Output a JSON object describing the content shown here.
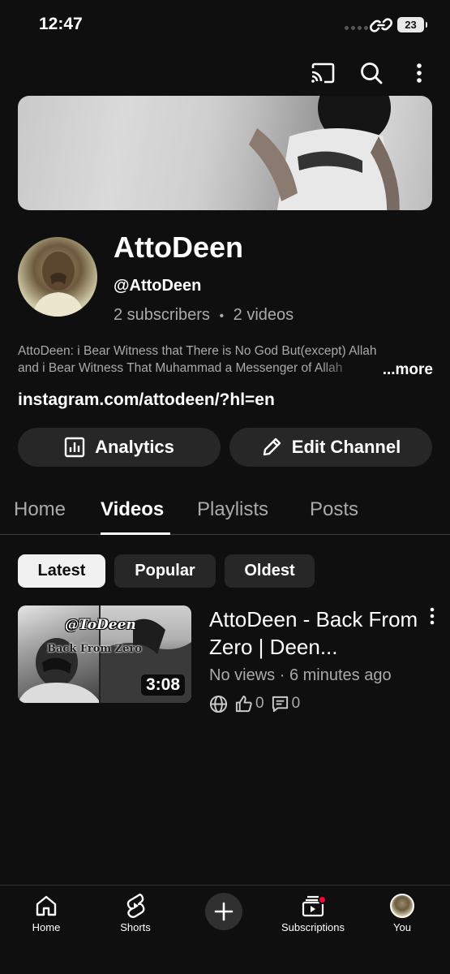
{
  "status_bar": {
    "time": "12:47",
    "battery": "23",
    "icons": [
      "signal-dots-icon",
      "link-icon",
      "battery-icon"
    ]
  },
  "top_bar": {
    "icons": [
      "cast-icon",
      "search-icon",
      "more-vert-icon"
    ]
  },
  "channel": {
    "name": "AttoDeen",
    "handle": "@AttoDeen",
    "subscribers": "2 subscribers",
    "separator": "•",
    "videos": "2 videos",
    "description_line1": "AttoDeen: i Bear Witness that There is No God But(except) Allah",
    "description_line2": "and i Bear Witness That Muhammad a Messenger of Allah",
    "description_more": "...more",
    "link": "instagram.com/attodeen/?hl=en"
  },
  "actions": {
    "analytics_label": "Analytics",
    "edit_label": "Edit Channel"
  },
  "tabs": [
    {
      "label": "Home",
      "active": false
    },
    {
      "label": "Videos",
      "active": true
    },
    {
      "label": "Playlists",
      "active": false
    },
    {
      "label": "Posts",
      "active": false
    }
  ],
  "filters": [
    {
      "label": "Latest",
      "active": true
    },
    {
      "label": "Popular",
      "active": false
    },
    {
      "label": "Oldest",
      "active": false
    }
  ],
  "videos": [
    {
      "title": "AttoDeen - Back From Zero | Deen...",
      "thumbnail_tag": "@ToDeen",
      "thumbnail_subtag": "Back From Zero",
      "duration": "3:08",
      "views": "No views",
      "meta_sep": "·",
      "age": "6 minutes ago",
      "likes": "0",
      "comments": "0"
    }
  ],
  "bottom_nav": [
    {
      "label": "Home",
      "icon": "home-icon"
    },
    {
      "label": "Shorts",
      "icon": "shorts-icon"
    },
    {
      "label": "",
      "icon": "create-plus-icon"
    },
    {
      "label": "Subscriptions",
      "icon": "subscriptions-icon"
    },
    {
      "label": "You",
      "icon": "you-avatar"
    }
  ],
  "colors": {
    "background": "#0f0f0f",
    "surface": "#272727",
    "text_primary": "#f1f1f1",
    "text_secondary": "#aaaaaa",
    "notification": "#ff0033"
  }
}
